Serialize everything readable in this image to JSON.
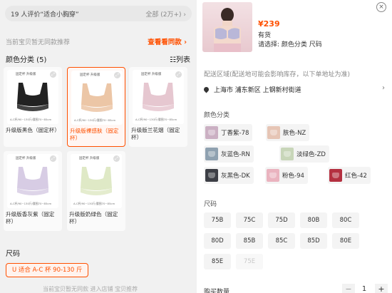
{
  "left": {
    "review": {
      "prefix": "19 人评价“适合小胸穿”",
      "suffix": "全部 (2万+)",
      "chevron": "›"
    },
    "no_recommendation": "当前宝贝暂无同款推荐",
    "view_more": "查看看同款 ›",
    "color_section": "颜色分类 (5)",
    "list_toggle": "☷列表",
    "variant_cards": [
      {
        "name": "升级版黑色（固定杯）",
        "tag": "固定杯 升级版",
        "spec": "A-C杯/90~130斤/腰围70~85cm",
        "bra_color": "#222222"
      },
      {
        "name": "升级版裸感肤（固定杯）",
        "tag": "固定杯 升级版",
        "spec": "A-C杯/90~130斤/腰围70~85cm",
        "bra_color": "#ecc6a6"
      },
      {
        "name": "升级版兰花烟（固定杯）",
        "tag": "固定杯 升级版",
        "spec": "A-C杯/90~130斤/腰围70~85cm",
        "bra_color": "#e6c7d0"
      },
      {
        "name": "升级版香灰紫（固定杯）",
        "tag": "固定杯 升级版",
        "spec": "A-C杯/90~130斤/腰围70~85cm",
        "bra_color": "#d7cce4"
      },
      {
        "name": "升级版奶绿色（固定杯）",
        "tag": "固定杯 升级版",
        "spec": "A-C杯/90~130斤/腰围70~85cm",
        "bra_color": "#dfe9c6"
      }
    ],
    "size_section": "尺码",
    "size_option": "U 适合 A-C 杯 90-130 斤",
    "bottom_hint": "当前宝贝暂无同款 进入店铺 宝贝推荐"
  },
  "right": {
    "price": "¥239",
    "stock": "有货",
    "choose": "请选择: 颜色分类  尺码",
    "close_glyph": "×",
    "address_hint": "配送区域(配送地可能会影响库存，以下单地址为准)",
    "address": "上海市 浦东新区 上钢新村街道",
    "address_arrow": "›",
    "color_section": "颜色分类",
    "colors": [
      {
        "label": "丁香紫-78",
        "swatch": "#cbb0c3"
      },
      {
        "label": "肤色-NZ",
        "swatch": "#e6c5b5"
      },
      {
        "label": "灰蓝色-RN",
        "swatch": "#8fa1b0"
      },
      {
        "label": "淡绿色-ZD",
        "swatch": "#c8d6b9"
      },
      {
        "label": "灰黑色-DK",
        "swatch": "#3d3f46"
      },
      {
        "label": "粉色-94",
        "swatch": "#eab3bf"
      },
      {
        "label": "红色-42",
        "swatch": "#b43040"
      }
    ],
    "size_section": "尺码",
    "sizes": [
      "75B",
      "75C",
      "75D",
      "80B",
      "80C",
      "80D",
      "85B",
      "85C",
      "85D",
      "80E",
      "85E",
      "75E"
    ],
    "disabled_sizes": [
      "75E"
    ],
    "quantity_label": "购买数量",
    "quantity_minus": "−",
    "quantity": "1",
    "quantity_plus": "+",
    "colors_theme": {
      "accent": "#ff5000"
    }
  }
}
